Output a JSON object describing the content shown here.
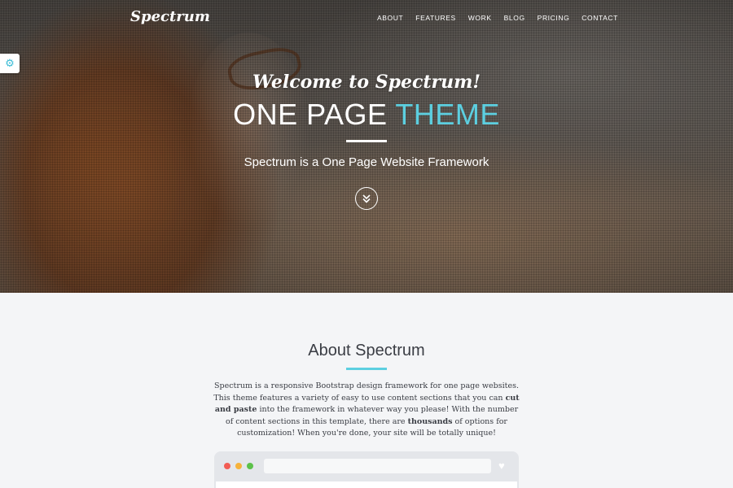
{
  "brand": {
    "logo": "Spectrum"
  },
  "nav": {
    "items": [
      "ABOUT",
      "FEATURES",
      "WORK",
      "BLOG",
      "PRICING",
      "CONTACT"
    ]
  },
  "settings": {
    "icon": "gear-icon"
  },
  "hero": {
    "welcome": "Welcome to Spectrum!",
    "headline_main": "ONE PAGE",
    "headline_accent": "THEME",
    "subtitle": "Spectrum is a One Page Website Framework",
    "scroll_icon": "double-chevron-down-icon"
  },
  "about": {
    "title": "About Spectrum",
    "text_1": "Spectrum is a responsive Bootstrap design framework for one page websites. This theme features a variety of easy to use content sections that you can ",
    "text_bold_1": "cut and paste",
    "text_2": " into the framework in whatever way you please! With the number of content sections in this template, there are ",
    "text_bold_2": "thousands",
    "text_3": " of options for customization! When you're done, your site will be totally unique!"
  },
  "browser": {
    "favorite_icon": "heart-icon"
  },
  "colors": {
    "accent": "#5ccfe0",
    "dot_red": "#f25c54",
    "dot_yellow": "#f6b23b",
    "dot_green": "#5cc14a"
  }
}
